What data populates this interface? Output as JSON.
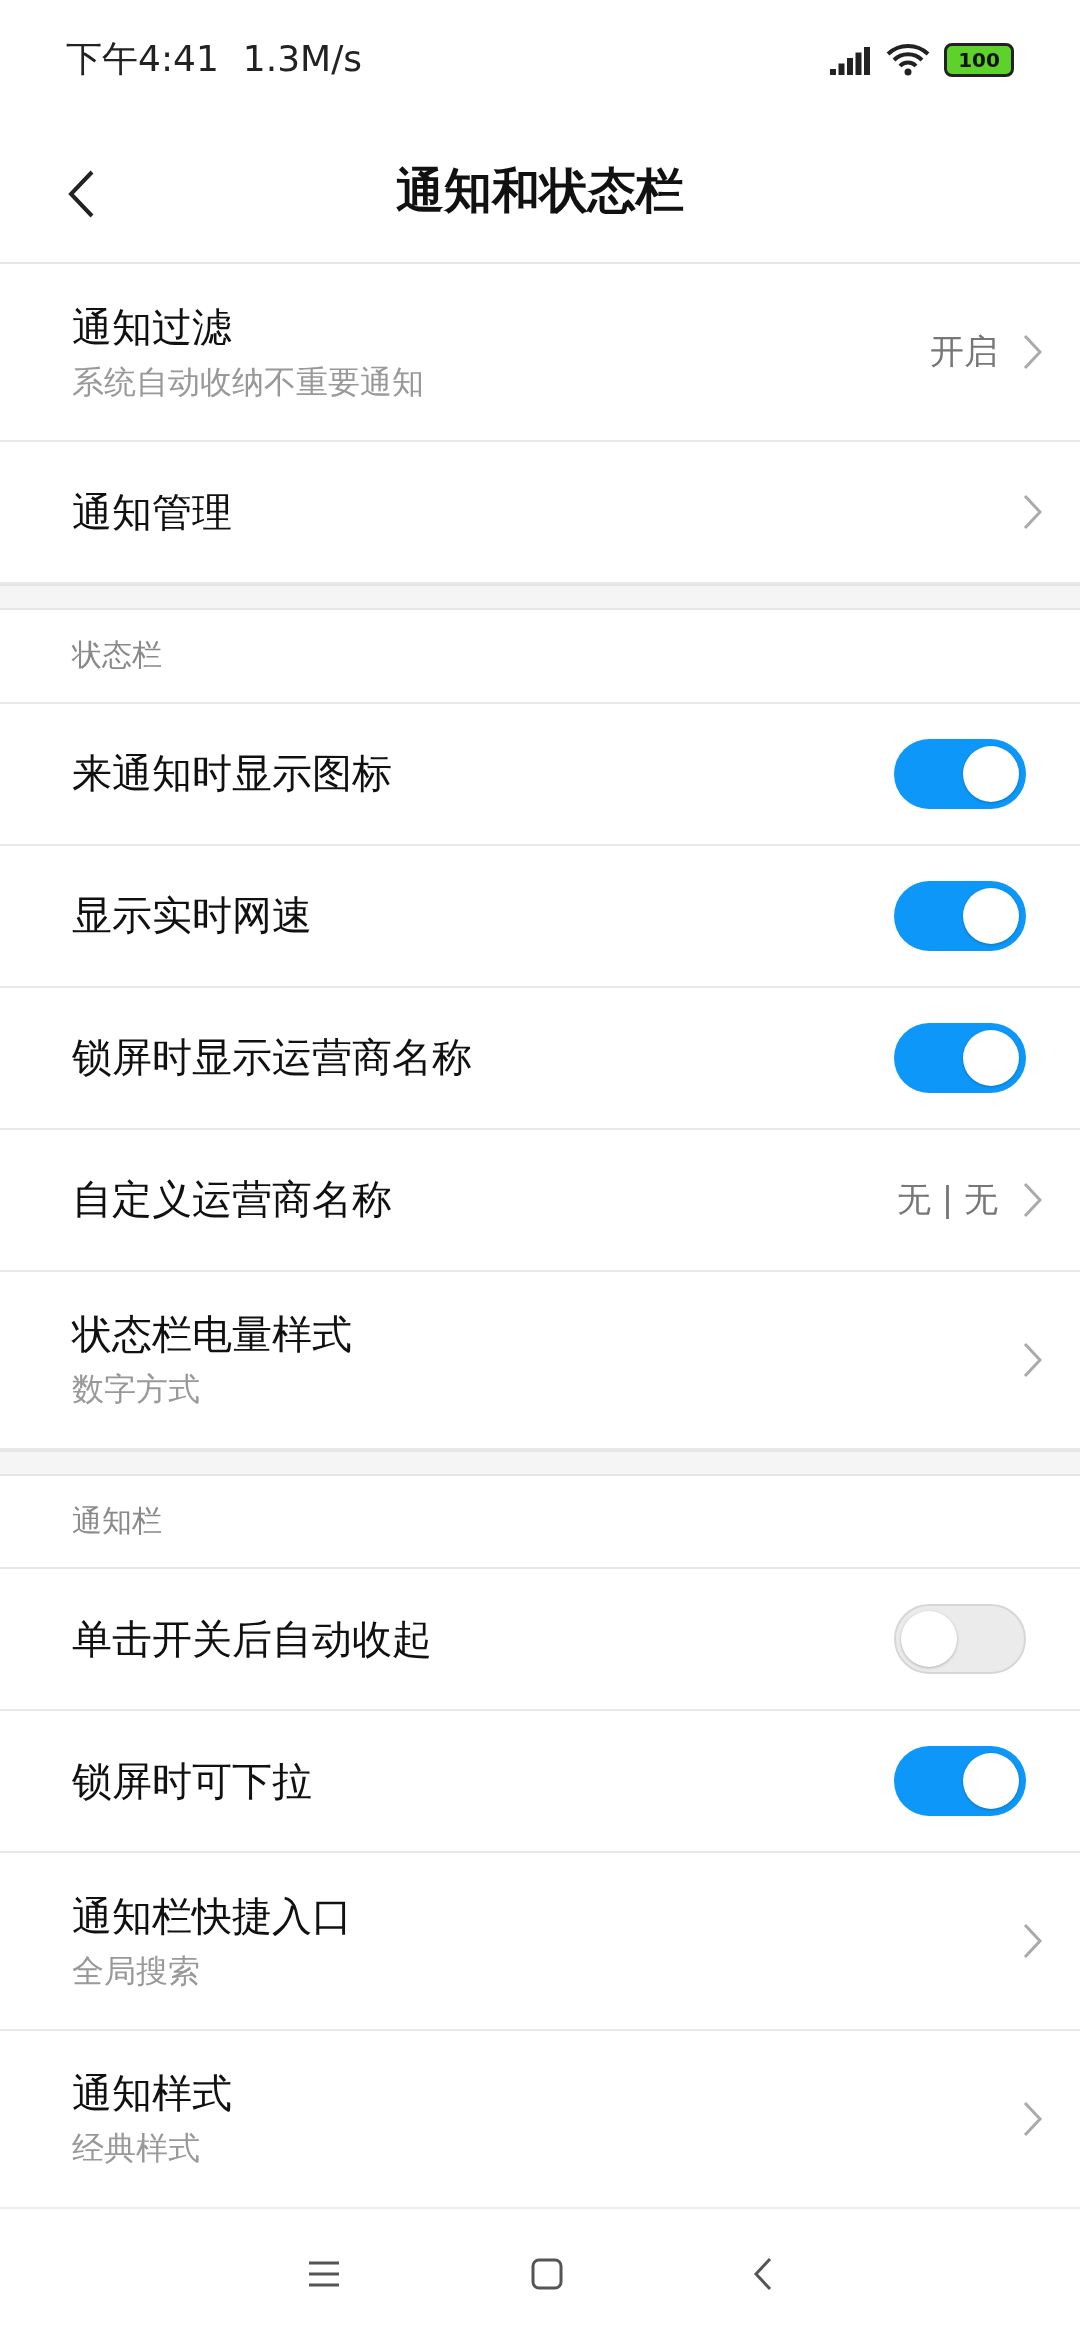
{
  "status_bar": {
    "time": "下午4:41",
    "speed": "1.3M/s",
    "battery": "100"
  },
  "header": {
    "title": "通知和状态栏"
  },
  "sections": [
    {
      "items": [
        {
          "kind": "link",
          "label": "通知过滤",
          "subtitle": "系统自动收纳不重要通知",
          "value": "开启"
        },
        {
          "kind": "link",
          "label": "通知管理"
        }
      ]
    },
    {
      "title": "状态栏",
      "items": [
        {
          "kind": "toggle",
          "label": "来通知时显示图标",
          "on": true
        },
        {
          "kind": "toggle",
          "label": "显示实时网速",
          "on": true
        },
        {
          "kind": "toggle",
          "label": "锁屏时显示运营商名称",
          "on": true
        },
        {
          "kind": "link",
          "label": "自定义运营商名称",
          "value": "无 | 无"
        },
        {
          "kind": "link",
          "label": "状态栏电量样式",
          "subtitle": "数字方式"
        }
      ]
    },
    {
      "title": "通知栏",
      "items": [
        {
          "kind": "toggle",
          "label": "单击开关后自动收起",
          "on": false
        },
        {
          "kind": "toggle",
          "label": "锁屏时可下拉",
          "on": true
        },
        {
          "kind": "link",
          "label": "通知栏快捷入口",
          "subtitle": "全局搜索"
        },
        {
          "kind": "link",
          "label": "通知样式",
          "subtitle": "经典样式"
        }
      ]
    }
  ]
}
